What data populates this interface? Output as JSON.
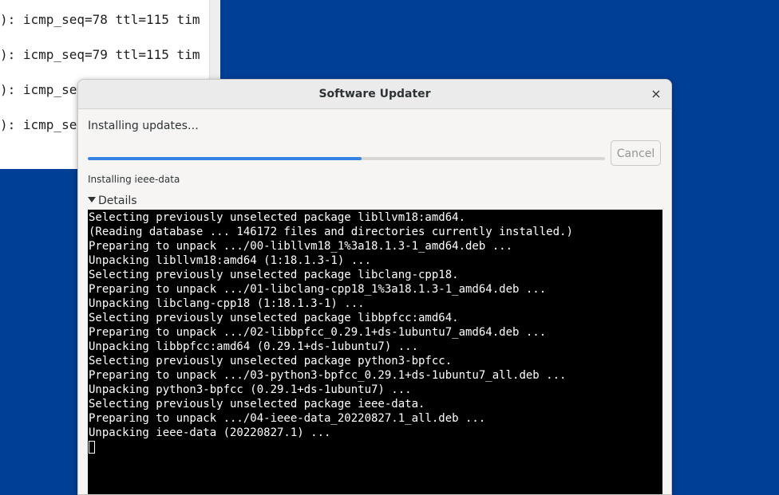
{
  "background_terminal": {
    "lines": [
      "): icmp_seq=78 ttl=115 tim",
      "): icmp_seq=79 ttl=115 tim",
      "): icmp_se",
      "): icmp_se"
    ]
  },
  "dialog": {
    "title": "Software Updater",
    "close_glyph": "×",
    "status": "Installing updates…",
    "progress_fraction": 0.53,
    "cancel_label": "Cancel",
    "sub_status": "Installing ieee-data",
    "details_label": "Details",
    "console_lines": [
      "Selecting previously unselected package libllvm18:amd64.",
      "(Reading database ... 146172 files and directories currently installed.)",
      "Preparing to unpack .../00-libllvm18_1%3a18.1.3-1_amd64.deb ...",
      "Unpacking libllvm18:amd64 (1:18.1.3-1) ...",
      "Selecting previously unselected package libclang-cpp18.",
      "Preparing to unpack .../01-libclang-cpp18_1%3a18.1.3-1_amd64.deb ...",
      "Unpacking libclang-cpp18 (1:18.1.3-1) ...",
      "Selecting previously unselected package libbpfcc:amd64.",
      "Preparing to unpack .../02-libbpfcc_0.29.1+ds-1ubuntu7_amd64.deb ...",
      "Unpacking libbpfcc:amd64 (0.29.1+ds-1ubuntu7) ...",
      "Selecting previously unselected package python3-bpfcc.",
      "Preparing to unpack .../03-python3-bpfcc_0.29.1+ds-1ubuntu7_all.deb ...",
      "Unpacking python3-bpfcc (0.29.1+ds-1ubuntu7) ...",
      "Selecting previously unselected package ieee-data.",
      "Preparing to unpack .../04-ieee-data_20220827.1_all.deb ...",
      "Unpacking ieee-data (20220827.1) ..."
    ]
  },
  "colors": {
    "desktop": "#003f96",
    "progress": "#3584e4",
    "console_bg": "#000000"
  }
}
